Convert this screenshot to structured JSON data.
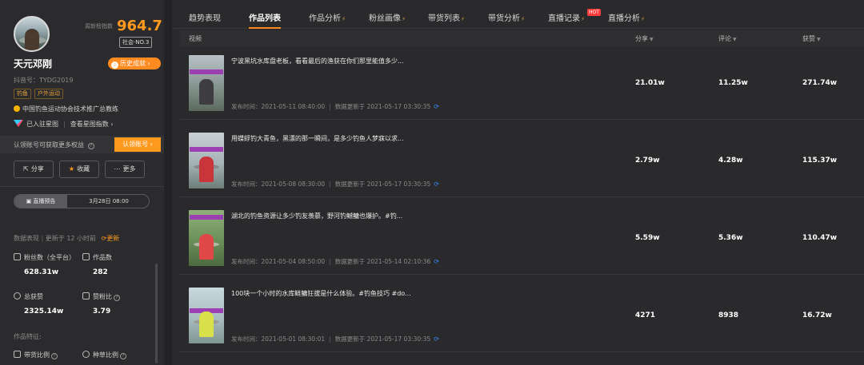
{
  "profile": {
    "index_label": "周新榜指数",
    "index_value": "964.7",
    "rank": "社会·NO.3",
    "name": "天元邓刚",
    "history_button": "历史成就",
    "douyin_id": "抖音号：TYDG2019",
    "tags": [
      "钓鱼",
      "户外运动"
    ],
    "certification": "中国钓鱼运动协会技术推广总教练",
    "star_joined": "已入驻星图",
    "star_index_link": "查看星图指数"
  },
  "claim": {
    "text": "认领账号可获取更多权益",
    "button": "认领账号"
  },
  "actions": {
    "share": "分享",
    "collect": "收藏",
    "more": "更多"
  },
  "live": {
    "label": "直播预告",
    "time": "3月28日 08:00"
  },
  "data_overview": {
    "label": "数据表现",
    "updated": "更新于 12 小时前",
    "refresh": "更新"
  },
  "stats": {
    "fans_label": "粉丝数（全平台）",
    "fans_value": "628.31w",
    "works_label": "作品数",
    "works_value": "282",
    "likes_label": "总获赞",
    "likes_value": "2325.14w",
    "ratio_label": "赞粉比",
    "ratio_value": "3.79"
  },
  "features": {
    "label": "作品特征:",
    "goods_ratio": "带货比例",
    "grass_ratio": "种草比例"
  },
  "tabs": [
    {
      "label": "趋势表现"
    },
    {
      "label": "作品列表"
    },
    {
      "label": "作品分析"
    },
    {
      "label": "粉丝画像"
    },
    {
      "label": "带货列表"
    },
    {
      "label": "带货分析"
    },
    {
      "label": "直播记录"
    },
    {
      "label": "直播分析"
    }
  ],
  "hot_badge": "HOT",
  "table": {
    "columns": {
      "video": "视频",
      "share": "分享",
      "comment": "评论",
      "likes": "获赞"
    },
    "rows": [
      {
        "title": "宁波黑坑水库盘老板，看看最后的渔获在你们那里能值多少...",
        "published": "发布时间：2021-05-11 08:40:00",
        "updated": "数据更新于 2021-05-17 03:30:35",
        "share": "21.01w",
        "comment": "11.25w",
        "likes": "271.74w"
      },
      {
        "title": "用蝶蜉钓大青鱼，黑漂的那一瞬间，是多少钓鱼人梦寐以求...",
        "published": "发布时间：2021-05-08 08:30:00",
        "updated": "数据更新于 2021-05-17 03:30:35",
        "share": "2.79w",
        "comment": "4.28w",
        "likes": "115.37w"
      },
      {
        "title": "湖北的钓鱼资源让多少钓友羡慕，野河钓鳡鳙也爆护。#钓...",
        "published": "发布时间：2021-05-04 08:50:00",
        "updated": "数据更新于 2021-05-14 02:10:36",
        "share": "5.59w",
        "comment": "5.36w",
        "likes": "110.47w"
      },
      {
        "title": "100块一个小时的水库鲢鳙狂拔是什么体验。#钓鱼技巧 #do...",
        "published": "发布时间：2021-05-01 08:30:01",
        "updated": "数据更新于 2021-05-17 03:30:35",
        "share": "4271",
        "comment": "8938",
        "likes": "16.72w"
      }
    ]
  },
  "colors": {
    "accent": "#ff8a1f",
    "index": "#ff9a1f",
    "background": "#232325",
    "panel": "#2a2a2c",
    "sync": "#3a8dff"
  }
}
